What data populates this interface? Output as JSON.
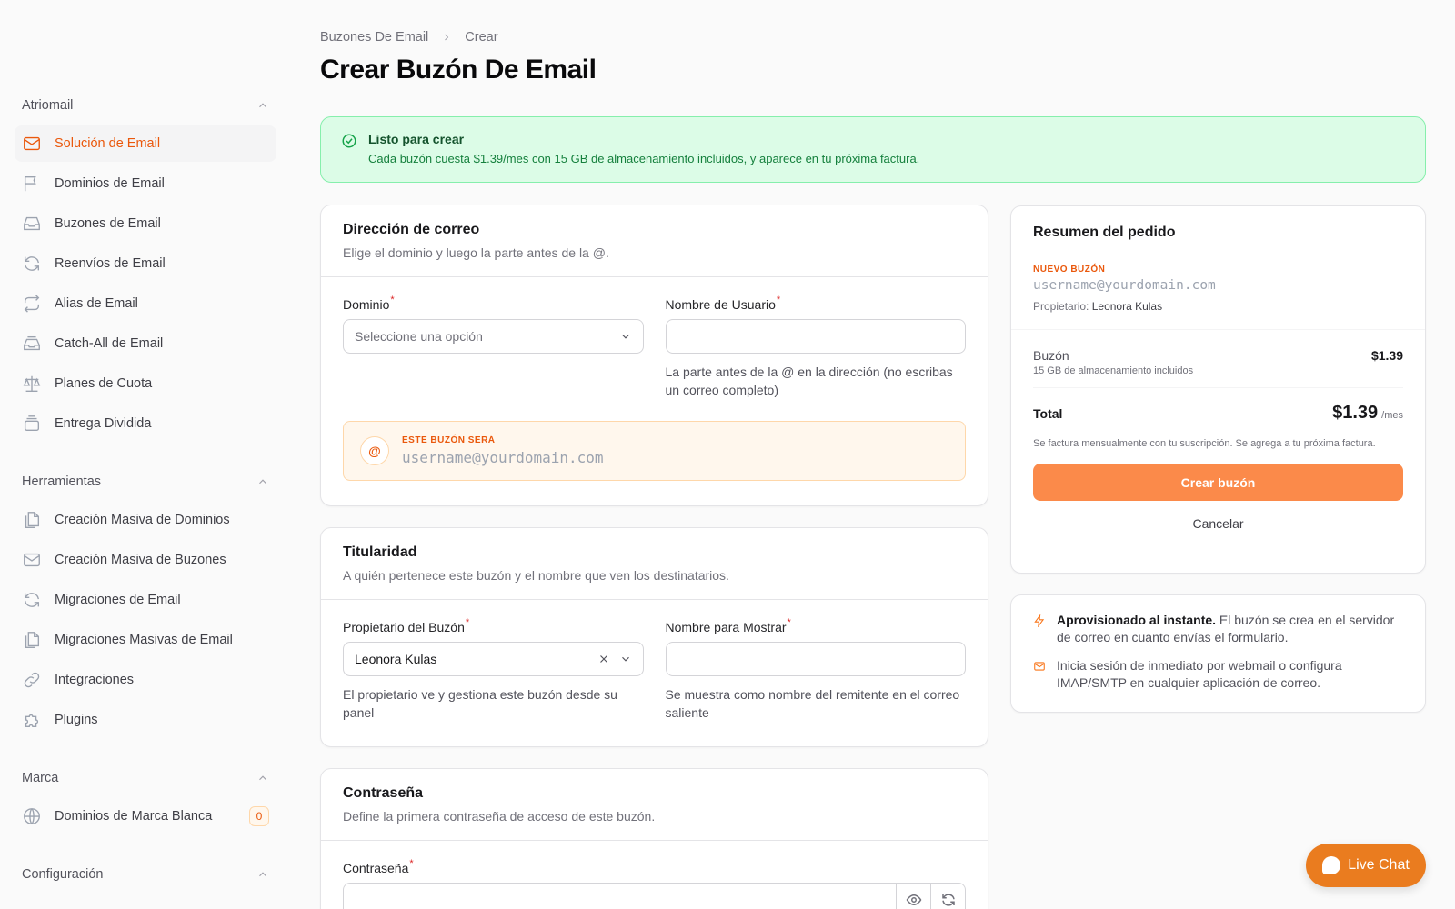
{
  "sidebar": {
    "groups": [
      {
        "title": "Atriomail",
        "items": [
          {
            "label": "Solución de Email",
            "icon": "mail-icon"
          },
          {
            "label": "Dominios de Email",
            "icon": "flag-icon"
          },
          {
            "label": "Buzones de Email",
            "icon": "inbox-icon"
          },
          {
            "label": "Reenvíos de Email",
            "icon": "refresh-icon"
          },
          {
            "label": "Alias de Email",
            "icon": "repeat-icon"
          },
          {
            "label": "Catch-All de Email",
            "icon": "inbox-stack-icon"
          },
          {
            "label": "Planes de Cuota",
            "icon": "scale-icon"
          },
          {
            "label": "Entrega Dividida",
            "icon": "stack-icon"
          }
        ]
      },
      {
        "title": "Herramientas",
        "items": [
          {
            "label": "Creación Masiva de Dominios",
            "icon": "documents-icon"
          },
          {
            "label": "Creación Masiva de Buzones",
            "icon": "mail-icon"
          },
          {
            "label": "Migraciones de Email",
            "icon": "refresh-icon"
          },
          {
            "label": "Migraciones Masivas de Email",
            "icon": "documents-icon"
          },
          {
            "label": "Integraciones",
            "icon": "link-icon"
          },
          {
            "label": "Plugins",
            "icon": "puzzle-icon"
          }
        ]
      },
      {
        "title": "Marca",
        "items": [
          {
            "label": "Dominios de Marca Blanca",
            "icon": "globe-icon",
            "badge": "0"
          }
        ]
      },
      {
        "title": "Configuración",
        "items": []
      }
    ]
  },
  "breadcrumb": {
    "parent": "Buzones De Email",
    "current": "Crear"
  },
  "page_title": "Crear Buzón De Email",
  "alert": {
    "title": "Listo para crear",
    "text": "Cada buzón cuesta $1.39/mes con 15 GB de almacenamiento incluidos, y aparece en tu próxima factura."
  },
  "address_card": {
    "title": "Dirección de correo",
    "subtitle": "Elige el dominio y luego la parte antes de la @.",
    "domain_label": "Dominio",
    "domain_placeholder": "Seleccione una opción",
    "username_label": "Nombre de Usuario",
    "username_help": "La parte antes de la @ en la dirección (no escribas un correo completo)",
    "preview_symbol": "@",
    "preview_label": "ESTE BUZÓN SERÁ",
    "preview_value": "username@yourdomain.com"
  },
  "ownership_card": {
    "title": "Titularidad",
    "subtitle": "A quién pertenece este buzón y el nombre que ven los destinatarios.",
    "owner_label": "Propietario del Buzón",
    "owner_value": "Leonora Kulas",
    "owner_help": "El propietario ve y gestiona este buzón desde su panel",
    "display_label": "Nombre para Mostrar",
    "display_help": "Se muestra como nombre del remitente en el correo saliente"
  },
  "password_card": {
    "title": "Contraseña",
    "subtitle": "Define la primera contraseña de acceso de este buzón.",
    "password_label": "Contraseña"
  },
  "summary": {
    "title": "Resumen del pedido",
    "new_label": "NUEVO BUZÓN",
    "address": "username@yourdomain.com",
    "owner_prefix": "Propietario:",
    "owner_name": "Leonora Kulas",
    "item_label": "Buzón",
    "item_sub": "15 GB de almacenamiento incluidos",
    "item_price": "$1.39",
    "total_label": "Total",
    "total_value": "$1.39",
    "total_unit": "/mes",
    "billing_note": "Se factura mensualmente con tu suscripción. Se agrega a tu próxima factura.",
    "create_button": "Crear buzón",
    "cancel_button": "Cancelar"
  },
  "info": {
    "bold": "Aprovisionado al instante.",
    "line1": " El buzón se crea en el servidor de correo en cuanto envías el formulario.",
    "line2": "Inicia sesión de inmediato por webmail o configura IMAP/SMTP en cualquier aplicación de correo."
  },
  "chat": {
    "label": "Live Chat"
  },
  "colors": {
    "accent": "#ea580c",
    "button": "#fb8a4a",
    "success_bg": "#dcfce7"
  }
}
